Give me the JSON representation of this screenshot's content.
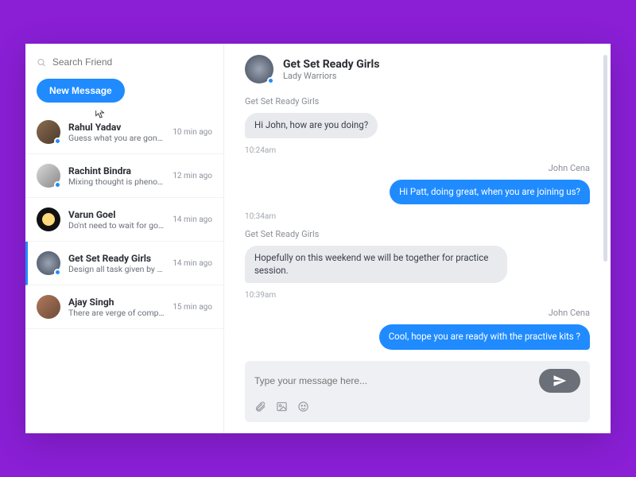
{
  "colors": {
    "accent": "#1f8bff",
    "purple": "#8a1fd6"
  },
  "sidebar": {
    "search_placeholder": "Search Friend",
    "new_message_label": "New Message",
    "items": [
      {
        "name": "Rahul Yadav",
        "preview": "Guess what you are gonna get with...",
        "time": "10 min ago",
        "online": true
      },
      {
        "name": "Rachint Bindra",
        "preview": "Mixing thought is phenomenal dis-...",
        "time": "12 min ago",
        "online": true
      },
      {
        "name": "Varun Goel",
        "preview": "Do'nt need to wait for good things t...",
        "time": "14 min ago",
        "online": false
      },
      {
        "name": "Get Set Ready Girls",
        "preview": "Design all task given by Ashwini on...",
        "time": "14 min ago",
        "online": true
      },
      {
        "name": "Ajay Singh",
        "preview": "There are verge of complexity in m...",
        "time": "15 min ago",
        "online": false
      }
    ],
    "active_index": 3
  },
  "chat": {
    "header": {
      "title": "Get Set Ready Girls",
      "subtitle": "Lady Warriors"
    },
    "messages": [
      {
        "from": "Get Set Ready Girls",
        "side": "in",
        "text": "Hi John, how are you doing?",
        "time": "10:24am"
      },
      {
        "from": "John Cena",
        "side": "out",
        "text": "Hi Patt, doing great, when you are joining us?",
        "time": "10:34am"
      },
      {
        "from": "Get Set Ready Girls",
        "side": "in",
        "text": "Hopefully on this weekend we will be together for practice session.",
        "time": "10:39am"
      },
      {
        "from": "John Cena",
        "side": "out",
        "text": "Cool, hope you are ready with the practive kits ?",
        "time": ""
      }
    ],
    "composer_placeholder": "Type your message here..."
  }
}
